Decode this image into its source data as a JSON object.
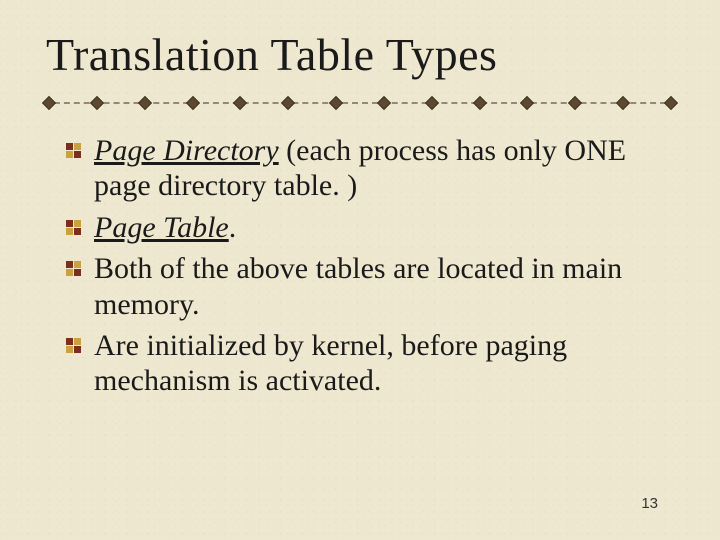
{
  "slide": {
    "title": "Translation Table Types",
    "bullets": [
      {
        "lead": "Page Directory",
        "rest": " (each process has only ONE page directory table. )"
      },
      {
        "lead": "Page Table",
        "rest": "."
      },
      {
        "lead": "",
        "rest": "Both of the above tables are located in main memory."
      },
      {
        "lead": "",
        "rest": "Are initialized by kernel, before paging mechanism is activated."
      }
    ],
    "page_number": "13"
  }
}
